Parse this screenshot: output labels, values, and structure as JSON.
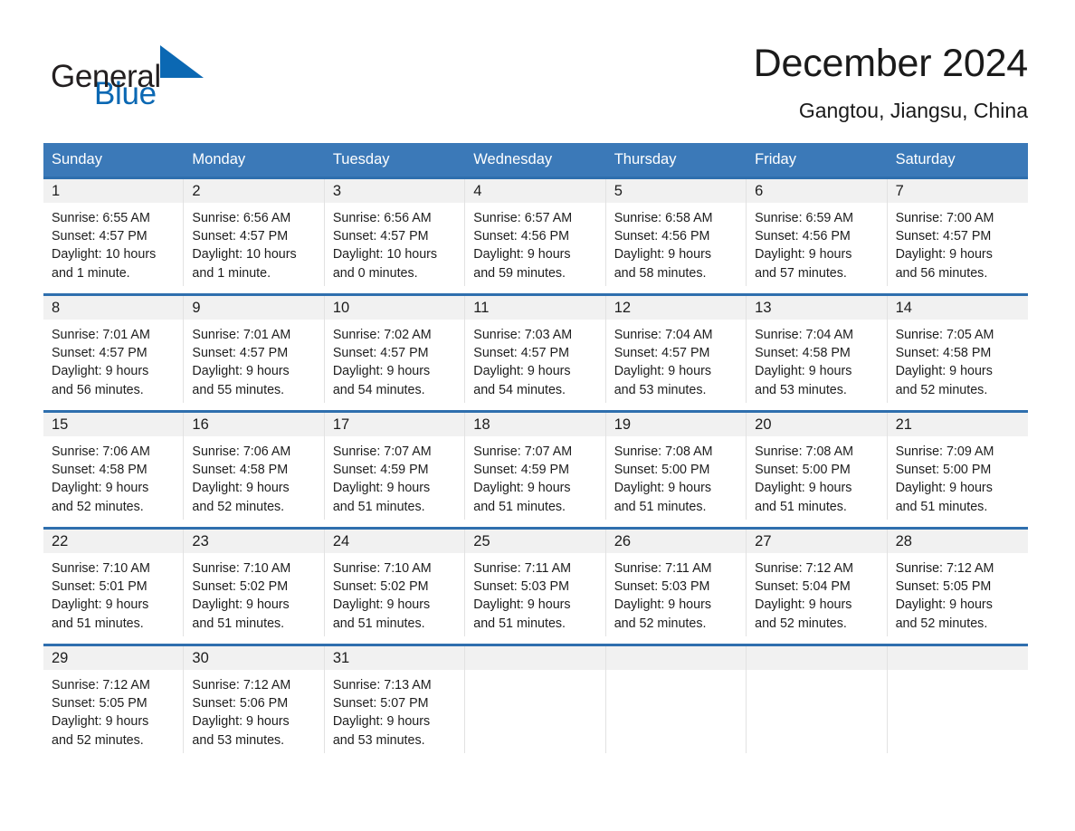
{
  "brand": {
    "name_part1": "General",
    "name_part2": "Blue",
    "logo_icon": "triangle-icon",
    "accent_color": "#0b68b3"
  },
  "header": {
    "title": "December 2024",
    "subtitle": "Gangtou, Jiangsu, China"
  },
  "calendar": {
    "header_bg": "#3b79b8",
    "week_divider_color": "#2f6fae",
    "daynum_bg": "#f1f1f1",
    "weekdays": [
      "Sunday",
      "Monday",
      "Tuesday",
      "Wednesday",
      "Thursday",
      "Friday",
      "Saturday"
    ],
    "weeks": [
      [
        {
          "day": "1",
          "sunrise": "Sunrise: 6:55 AM",
          "sunset": "Sunset: 4:57 PM",
          "daylight_line1": "Daylight: 10 hours",
          "daylight_line2": "and 1 minute."
        },
        {
          "day": "2",
          "sunrise": "Sunrise: 6:56 AM",
          "sunset": "Sunset: 4:57 PM",
          "daylight_line1": "Daylight: 10 hours",
          "daylight_line2": "and 1 minute."
        },
        {
          "day": "3",
          "sunrise": "Sunrise: 6:56 AM",
          "sunset": "Sunset: 4:57 PM",
          "daylight_line1": "Daylight: 10 hours",
          "daylight_line2": "and 0 minutes."
        },
        {
          "day": "4",
          "sunrise": "Sunrise: 6:57 AM",
          "sunset": "Sunset: 4:56 PM",
          "daylight_line1": "Daylight: 9 hours",
          "daylight_line2": "and 59 minutes."
        },
        {
          "day": "5",
          "sunrise": "Sunrise: 6:58 AM",
          "sunset": "Sunset: 4:56 PM",
          "daylight_line1": "Daylight: 9 hours",
          "daylight_line2": "and 58 minutes."
        },
        {
          "day": "6",
          "sunrise": "Sunrise: 6:59 AM",
          "sunset": "Sunset: 4:56 PM",
          "daylight_line1": "Daylight: 9 hours",
          "daylight_line2": "and 57 minutes."
        },
        {
          "day": "7",
          "sunrise": "Sunrise: 7:00 AM",
          "sunset": "Sunset: 4:57 PM",
          "daylight_line1": "Daylight: 9 hours",
          "daylight_line2": "and 56 minutes."
        }
      ],
      [
        {
          "day": "8",
          "sunrise": "Sunrise: 7:01 AM",
          "sunset": "Sunset: 4:57 PM",
          "daylight_line1": "Daylight: 9 hours",
          "daylight_line2": "and 56 minutes."
        },
        {
          "day": "9",
          "sunrise": "Sunrise: 7:01 AM",
          "sunset": "Sunset: 4:57 PM",
          "daylight_line1": "Daylight: 9 hours",
          "daylight_line2": "and 55 minutes."
        },
        {
          "day": "10",
          "sunrise": "Sunrise: 7:02 AM",
          "sunset": "Sunset: 4:57 PM",
          "daylight_line1": "Daylight: 9 hours",
          "daylight_line2": "and 54 minutes."
        },
        {
          "day": "11",
          "sunrise": "Sunrise: 7:03 AM",
          "sunset": "Sunset: 4:57 PM",
          "daylight_line1": "Daylight: 9 hours",
          "daylight_line2": "and 54 minutes."
        },
        {
          "day": "12",
          "sunrise": "Sunrise: 7:04 AM",
          "sunset": "Sunset: 4:57 PM",
          "daylight_line1": "Daylight: 9 hours",
          "daylight_line2": "and 53 minutes."
        },
        {
          "day": "13",
          "sunrise": "Sunrise: 7:04 AM",
          "sunset": "Sunset: 4:58 PM",
          "daylight_line1": "Daylight: 9 hours",
          "daylight_line2": "and 53 minutes."
        },
        {
          "day": "14",
          "sunrise": "Sunrise: 7:05 AM",
          "sunset": "Sunset: 4:58 PM",
          "daylight_line1": "Daylight: 9 hours",
          "daylight_line2": "and 52 minutes."
        }
      ],
      [
        {
          "day": "15",
          "sunrise": "Sunrise: 7:06 AM",
          "sunset": "Sunset: 4:58 PM",
          "daylight_line1": "Daylight: 9 hours",
          "daylight_line2": "and 52 minutes."
        },
        {
          "day": "16",
          "sunrise": "Sunrise: 7:06 AM",
          "sunset": "Sunset: 4:58 PM",
          "daylight_line1": "Daylight: 9 hours",
          "daylight_line2": "and 52 minutes."
        },
        {
          "day": "17",
          "sunrise": "Sunrise: 7:07 AM",
          "sunset": "Sunset: 4:59 PM",
          "daylight_line1": "Daylight: 9 hours",
          "daylight_line2": "and 51 minutes."
        },
        {
          "day": "18",
          "sunrise": "Sunrise: 7:07 AM",
          "sunset": "Sunset: 4:59 PM",
          "daylight_line1": "Daylight: 9 hours",
          "daylight_line2": "and 51 minutes."
        },
        {
          "day": "19",
          "sunrise": "Sunrise: 7:08 AM",
          "sunset": "Sunset: 5:00 PM",
          "daylight_line1": "Daylight: 9 hours",
          "daylight_line2": "and 51 minutes."
        },
        {
          "day": "20",
          "sunrise": "Sunrise: 7:08 AM",
          "sunset": "Sunset: 5:00 PM",
          "daylight_line1": "Daylight: 9 hours",
          "daylight_line2": "and 51 minutes."
        },
        {
          "day": "21",
          "sunrise": "Sunrise: 7:09 AM",
          "sunset": "Sunset: 5:00 PM",
          "daylight_line1": "Daylight: 9 hours",
          "daylight_line2": "and 51 minutes."
        }
      ],
      [
        {
          "day": "22",
          "sunrise": "Sunrise: 7:10 AM",
          "sunset": "Sunset: 5:01 PM",
          "daylight_line1": "Daylight: 9 hours",
          "daylight_line2": "and 51 minutes."
        },
        {
          "day": "23",
          "sunrise": "Sunrise: 7:10 AM",
          "sunset": "Sunset: 5:02 PM",
          "daylight_line1": "Daylight: 9 hours",
          "daylight_line2": "and 51 minutes."
        },
        {
          "day": "24",
          "sunrise": "Sunrise: 7:10 AM",
          "sunset": "Sunset: 5:02 PM",
          "daylight_line1": "Daylight: 9 hours",
          "daylight_line2": "and 51 minutes."
        },
        {
          "day": "25",
          "sunrise": "Sunrise: 7:11 AM",
          "sunset": "Sunset: 5:03 PM",
          "daylight_line1": "Daylight: 9 hours",
          "daylight_line2": "and 51 minutes."
        },
        {
          "day": "26",
          "sunrise": "Sunrise: 7:11 AM",
          "sunset": "Sunset: 5:03 PM",
          "daylight_line1": "Daylight: 9 hours",
          "daylight_line2": "and 52 minutes."
        },
        {
          "day": "27",
          "sunrise": "Sunrise: 7:12 AM",
          "sunset": "Sunset: 5:04 PM",
          "daylight_line1": "Daylight: 9 hours",
          "daylight_line2": "and 52 minutes."
        },
        {
          "day": "28",
          "sunrise": "Sunrise: 7:12 AM",
          "sunset": "Sunset: 5:05 PM",
          "daylight_line1": "Daylight: 9 hours",
          "daylight_line2": "and 52 minutes."
        }
      ],
      [
        {
          "day": "29",
          "sunrise": "Sunrise: 7:12 AM",
          "sunset": "Sunset: 5:05 PM",
          "daylight_line1": "Daylight: 9 hours",
          "daylight_line2": "and 52 minutes."
        },
        {
          "day": "30",
          "sunrise": "Sunrise: 7:12 AM",
          "sunset": "Sunset: 5:06 PM",
          "daylight_line1": "Daylight: 9 hours",
          "daylight_line2": "and 53 minutes."
        },
        {
          "day": "31",
          "sunrise": "Sunrise: 7:13 AM",
          "sunset": "Sunset: 5:07 PM",
          "daylight_line1": "Daylight: 9 hours",
          "daylight_line2": "and 53 minutes."
        },
        {
          "day": "",
          "sunrise": "",
          "sunset": "",
          "daylight_line1": "",
          "daylight_line2": ""
        },
        {
          "day": "",
          "sunrise": "",
          "sunset": "",
          "daylight_line1": "",
          "daylight_line2": ""
        },
        {
          "day": "",
          "sunrise": "",
          "sunset": "",
          "daylight_line1": "",
          "daylight_line2": ""
        },
        {
          "day": "",
          "sunrise": "",
          "sunset": "",
          "daylight_line1": "",
          "daylight_line2": ""
        }
      ]
    ]
  }
}
